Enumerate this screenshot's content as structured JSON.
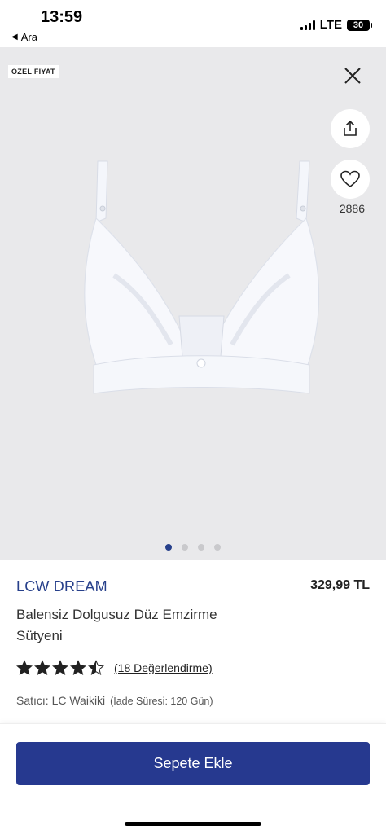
{
  "status_bar": {
    "time": "13:59",
    "back_label": "Ara",
    "network": "LTE",
    "battery": "30"
  },
  "gallery": {
    "badge": "ÖZEL FİYAT",
    "favorite_count": "2886",
    "image_count": 4,
    "active_image": 1,
    "icons": [
      "close-icon",
      "share-icon",
      "heart-icon"
    ]
  },
  "product": {
    "brand": "LCW DREAM",
    "price": "329,99 TL",
    "title": "Balensiz Dolgusuz Düz Emzirme Sütyeni",
    "rating": 4.5,
    "review_link": "(18 Değerlendirme)",
    "seller": "Satıcı: LC Waikiki",
    "return_period": "(İade Süresi: 120 Gün)"
  },
  "cart": {
    "button_label": "Sepete Ekle"
  },
  "colors": {
    "brand_blue": "#27408b",
    "button_blue": "#26398f",
    "gallery_bg": "#e9e9eb"
  }
}
